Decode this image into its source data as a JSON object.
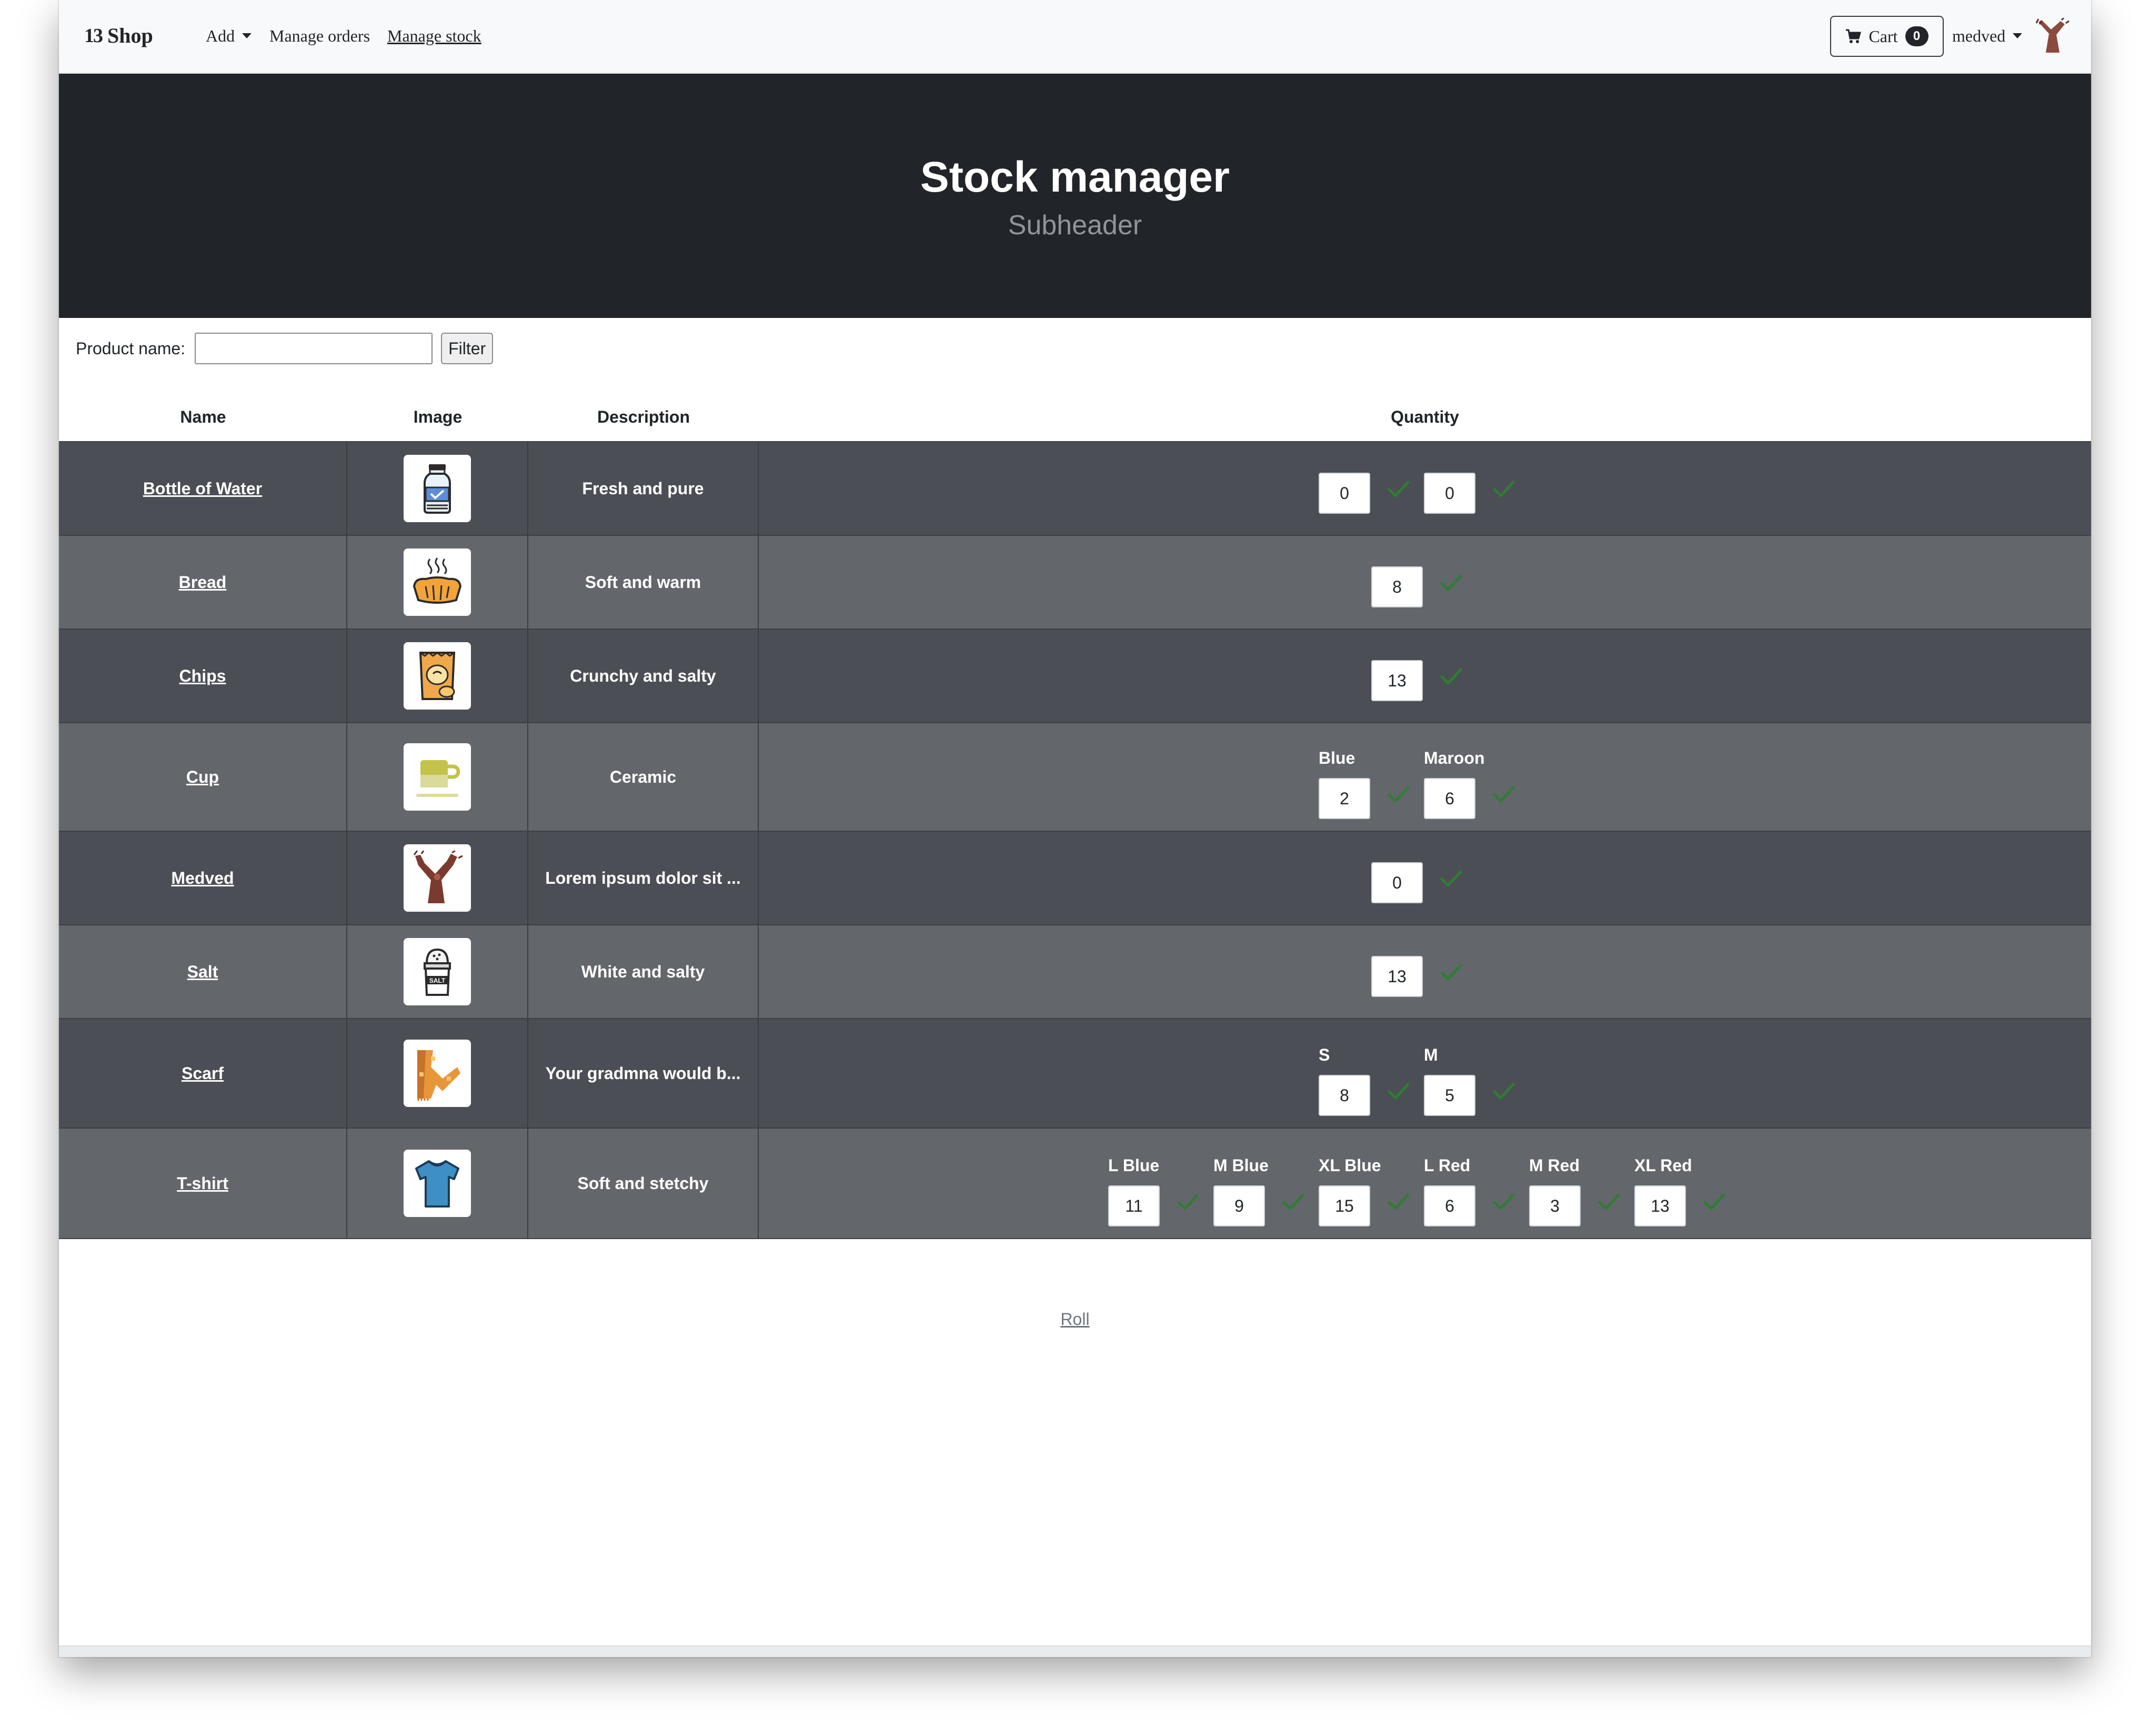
{
  "navbar": {
    "brand": "Shop",
    "brand_logo": "13",
    "add_label": "Add",
    "manage_orders": "Manage orders",
    "manage_stock": "Manage stock",
    "cart_label": "Cart",
    "cart_count": "0",
    "user": "medved"
  },
  "hero": {
    "title": "Stock manager",
    "subtitle": "Subheader"
  },
  "filter": {
    "label": "Product name:",
    "value": "",
    "button": "Filter"
  },
  "table": {
    "headers": {
      "name": "Name",
      "image": "Image",
      "description": "Description",
      "quantity": "Quantity"
    }
  },
  "products": [
    {
      "name": "Bottle of Water",
      "description": "Fresh and pure",
      "icon": "water-bottle-icon",
      "variants": [
        {
          "label": "",
          "qty": "0"
        },
        {
          "label": "",
          "qty": "0"
        }
      ]
    },
    {
      "name": "Bread",
      "description": "Soft and warm",
      "icon": "bread-icon",
      "variants": [
        {
          "label": "",
          "qty": "8"
        }
      ]
    },
    {
      "name": "Chips",
      "description": "Crunchy and salty",
      "icon": "chips-bag-icon",
      "variants": [
        {
          "label": "",
          "qty": "13"
        }
      ]
    },
    {
      "name": "Cup",
      "description": "Ceramic",
      "icon": "cup-icon",
      "variants": [
        {
          "label": "Blue",
          "qty": "2"
        },
        {
          "label": "Maroon",
          "qty": "6"
        }
      ]
    },
    {
      "name": "Medved",
      "description": "Lorem ipsum dolor sit ...",
      "icon": "medved-icon",
      "variants": [
        {
          "label": "",
          "qty": "0"
        }
      ]
    },
    {
      "name": "Salt",
      "description": "White and salty",
      "icon": "salt-shaker-icon",
      "variants": [
        {
          "label": "",
          "qty": "13"
        }
      ]
    },
    {
      "name": "Scarf",
      "description": "Your gradmna would b...",
      "icon": "scarf-icon",
      "variants": [
        {
          "label": "S",
          "qty": "8"
        },
        {
          "label": "M",
          "qty": "5"
        }
      ]
    },
    {
      "name": "T-shirt",
      "description": "Soft and stetchy",
      "icon": "tshirt-icon",
      "variants": [
        {
          "label": "L Blue",
          "qty": "11"
        },
        {
          "label": "M Blue",
          "qty": "9"
        },
        {
          "label": "XL Blue",
          "qty": "15"
        },
        {
          "label": "L Red",
          "qty": "6"
        },
        {
          "label": "M Red",
          "qty": "3"
        },
        {
          "label": "XL Red",
          "qty": "13"
        }
      ]
    }
  ],
  "footer": {
    "roll": "Roll"
  },
  "colors": {
    "hero_bg": "#212529",
    "row_dark": "#4b4f55",
    "row_light": "#63666b",
    "check_green": "#2e7d32"
  }
}
